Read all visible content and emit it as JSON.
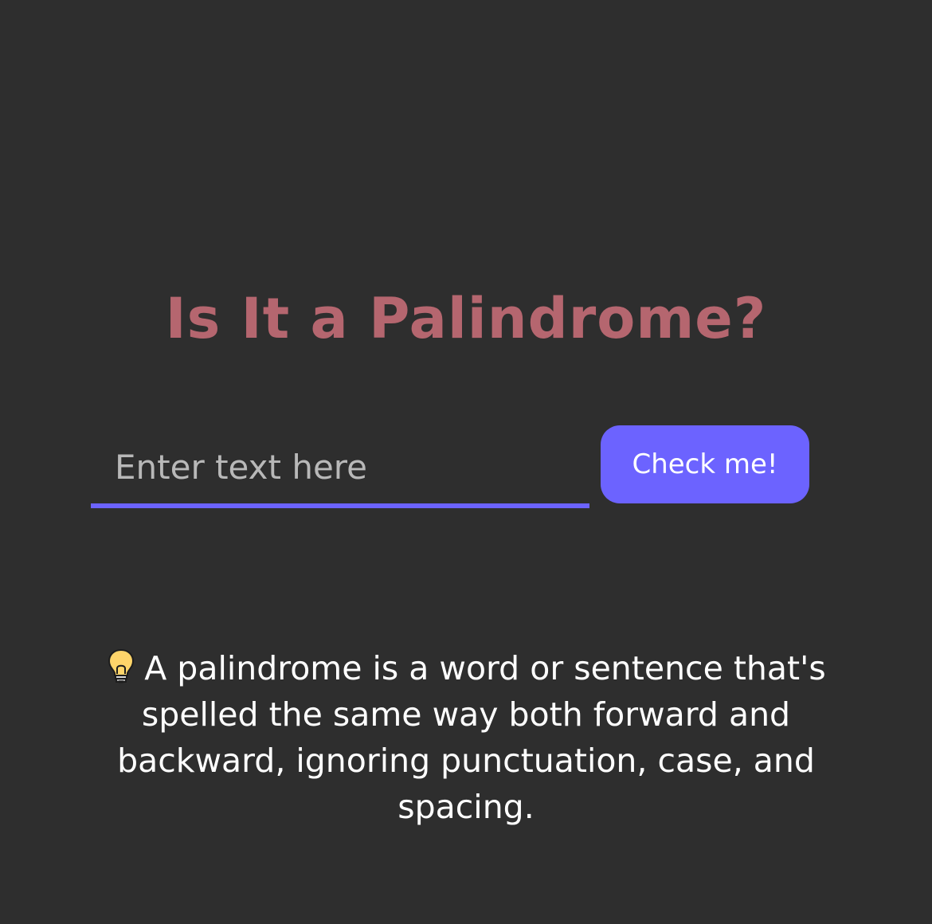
{
  "page": {
    "title": "Is It a Palindrome?",
    "input_placeholder": "Enter text here",
    "input_value": "",
    "button_label": "Check me!",
    "info_text": "A palindrome is a word or sentence that's spelled the same way both forward and backward, ignoring punctuation, case, and spacing.",
    "info_icon": "lightbulb-icon"
  },
  "colors": {
    "background": "#2e2e2e",
    "title": "#b5666f",
    "accent": "#6c63ff",
    "text": "#ffffff",
    "placeholder": "#b8b8b8"
  }
}
